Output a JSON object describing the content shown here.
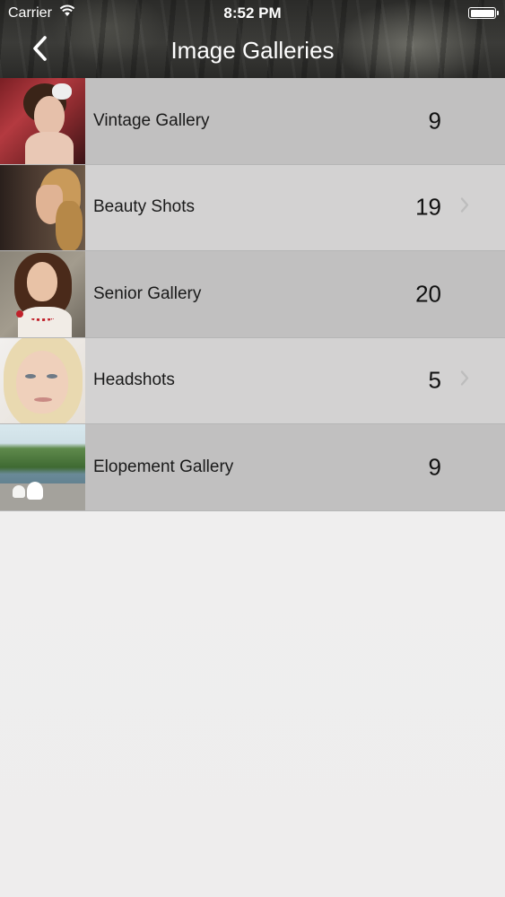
{
  "status_bar": {
    "carrier": "Carrier",
    "time": "8:52 PM",
    "wifi_icon": "wifi-icon",
    "battery_icon": "battery-icon"
  },
  "nav": {
    "title": "Image Galleries",
    "back_icon": "chevron-left-icon"
  },
  "galleries": [
    {
      "label": "Vintage Gallery",
      "count": "9",
      "thumbnail": "vintage-portrait",
      "chevron": false
    },
    {
      "label": "Beauty Shots",
      "count": "19",
      "thumbnail": "beauty-profile",
      "chevron": true
    },
    {
      "label": "Senior Gallery",
      "count": "20",
      "thumbnail": "senior-portrait",
      "chevron": false
    },
    {
      "label": "Headshots",
      "count": "5",
      "thumbnail": "blonde-headshot",
      "chevron": true
    },
    {
      "label": "Elopement Gallery",
      "count": "9",
      "thumbnail": "lake-elopement",
      "chevron": false
    }
  ],
  "colors": {
    "row_dark": "#c1c0c0",
    "row_light": "#d3d2d2",
    "background": "#efeeee",
    "nav_text": "#ffffff"
  }
}
